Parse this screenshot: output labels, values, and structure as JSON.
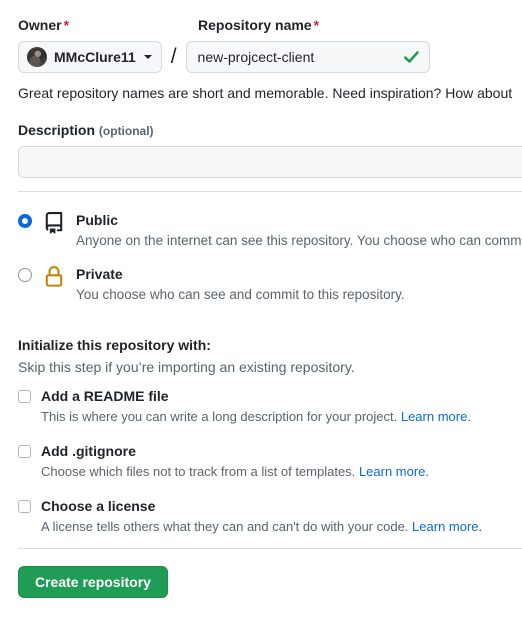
{
  "form": {
    "owner": {
      "label": "Owner",
      "required_mark": "*",
      "selected": "MMcClure11",
      "avatar_icon": "user-avatar-icon",
      "caret_icon": "chevron-down-icon"
    },
    "separator": "/",
    "repository_name": {
      "label": "Repository name",
      "required_mark": "*",
      "value": "new-projcect-client",
      "placeholder": "",
      "validation_icon": "check-icon",
      "validation_color": "#1a9e3f"
    },
    "name_helper": "Great repository names are short and memorable. Need inspiration? How about",
    "description": {
      "label": "Description",
      "optional_note": "(optional)",
      "value": "",
      "placeholder": ""
    },
    "visibility": {
      "options": [
        {
          "id": "public",
          "title": "Public",
          "description": "Anyone on the internet can see this repository. You choose who can commit.",
          "icon": "repo-book-icon",
          "icon_color": "#1f2328",
          "selected": true
        },
        {
          "id": "private",
          "title": "Private",
          "description": "You choose who can see and commit to this repository.",
          "icon": "lock-icon",
          "icon_color": "#bf8700",
          "selected": false
        }
      ]
    },
    "initialize": {
      "title": "Initialize this repository with:",
      "subtitle": "Skip this step if you’re importing an existing repository.",
      "items": [
        {
          "id": "readme",
          "label": "Add a README file",
          "description": "This is where you can write a long description for your project.",
          "link_text": "Learn more.",
          "checked": false
        },
        {
          "id": "gitignore",
          "label": "Add .gitignore",
          "description": "Choose which files not to track from a list of templates.",
          "link_text": "Learn more.",
          "checked": false
        },
        {
          "id": "license",
          "label": "Choose a license",
          "description": "A license tells others what they can and can't do with your code.",
          "link_text": "Learn more.",
          "checked": false
        }
      ]
    },
    "submit": {
      "label": "Create repository",
      "color": "#1f9d55"
    }
  }
}
